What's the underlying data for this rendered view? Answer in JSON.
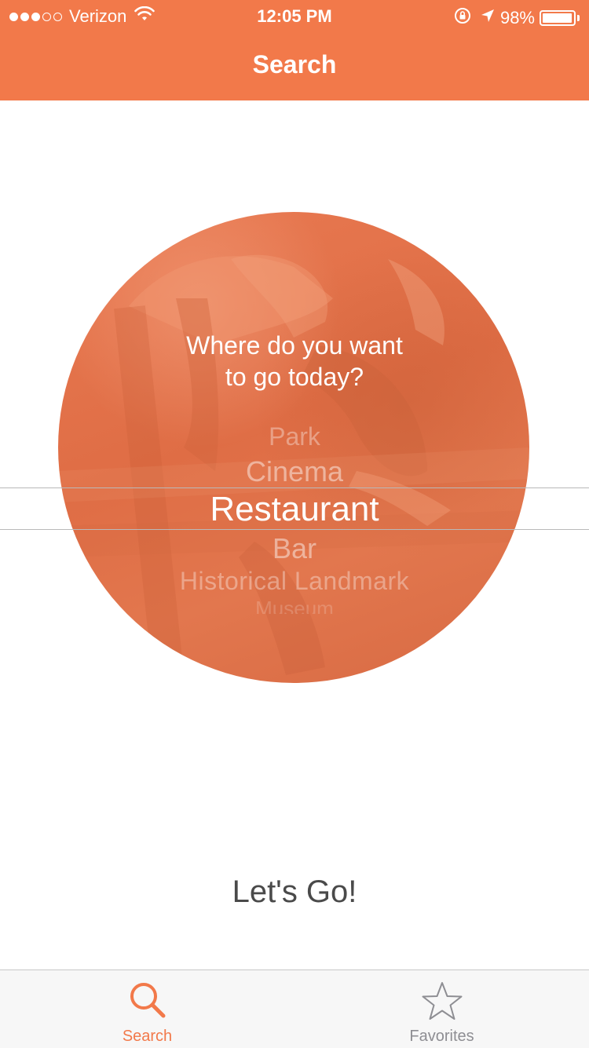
{
  "status_bar": {
    "carrier": "Verizon",
    "time": "12:05 PM",
    "battery": "98%",
    "battery_level": 0.98,
    "signal_bars_filled": 3,
    "signal_bars_total": 5
  },
  "nav": {
    "title": "Search"
  },
  "picker": {
    "question_line1": "Where do you want",
    "question_line2": "to go today?",
    "items": [
      "Park",
      "Cinema",
      "Restaurant",
      "Bar",
      "Historical Landmark",
      "Museum"
    ],
    "selected": "Restaurant"
  },
  "action": {
    "go_label": "Let's Go!"
  },
  "tabs": [
    {
      "label": "Search",
      "icon": "search-icon",
      "active": true
    },
    {
      "label": "Favorites",
      "icon": "star-icon",
      "active": false
    }
  ],
  "colors": {
    "accent": "#F2794A",
    "inactive": "#8e8e93"
  }
}
